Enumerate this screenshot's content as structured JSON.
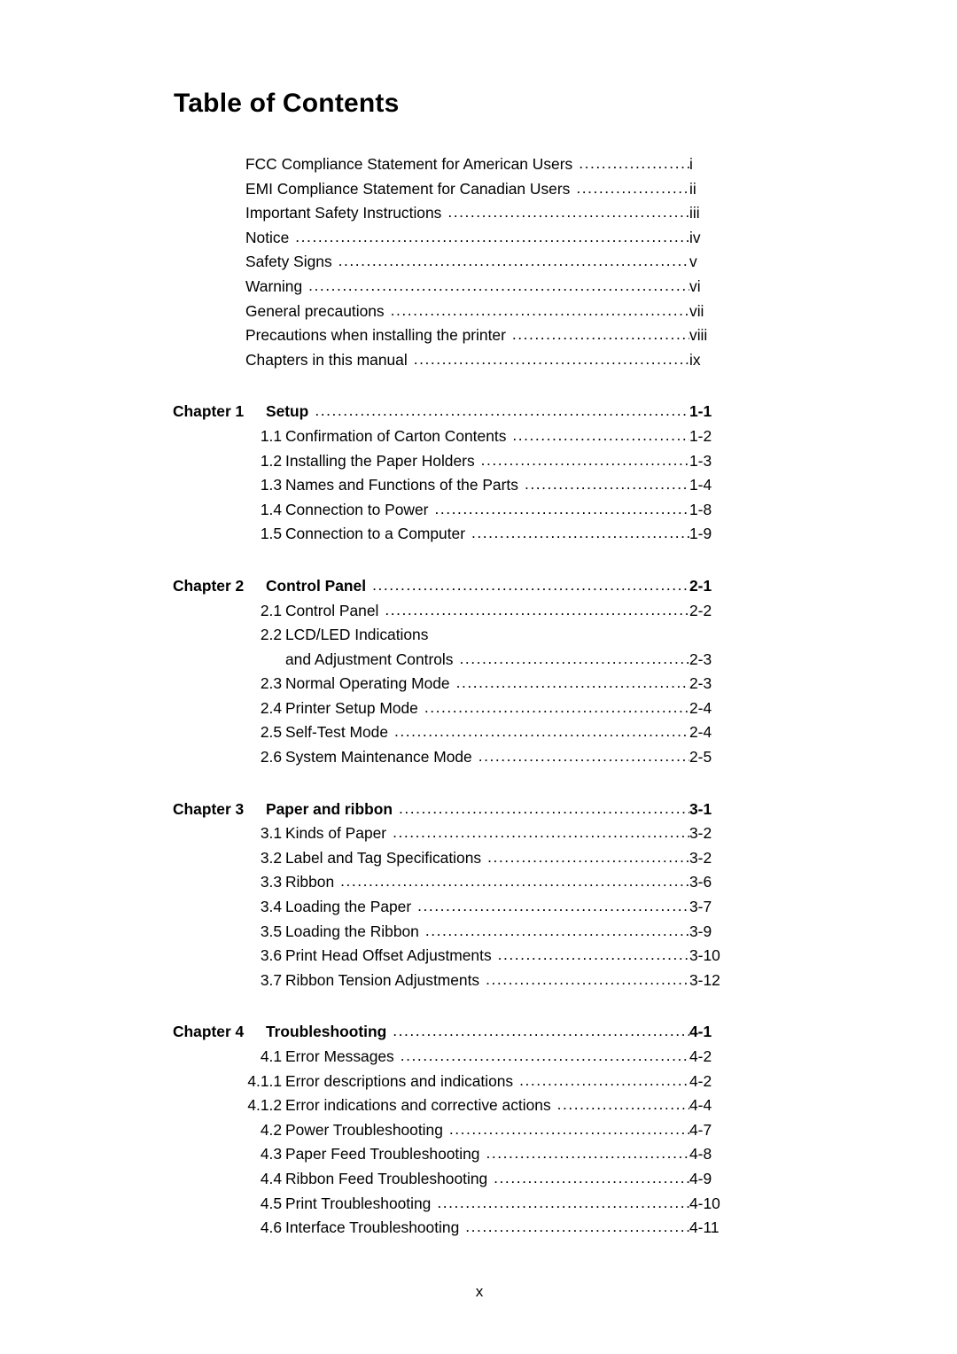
{
  "document": {
    "title": "Table of Contents",
    "folio": "x",
    "leader_char": "."
  },
  "front_matter": [
    {
      "title": "FCC Compliance Statement for American Users",
      "page": "i"
    },
    {
      "title": "EMI Compliance Statement for Canadian Users",
      "page": "ii"
    },
    {
      "title": "Important Safety Instructions",
      "page": "iii"
    },
    {
      "title": "Notice",
      "page": "iv"
    },
    {
      "title": "Safety Signs",
      "page": "v"
    },
    {
      "title": "Warning",
      "page": "vi"
    },
    {
      "title": "General precautions",
      "page": "vii"
    },
    {
      "title": "Precautions when installing the printer",
      "page": "viii"
    },
    {
      "title": "Chapters in this manual",
      "page": "ix"
    }
  ],
  "chapters": [
    {
      "label": "Chapter 1",
      "title": "Setup",
      "page": "1-1",
      "sections": [
        {
          "num": "1.1",
          "title": "Confirmation of Carton Contents",
          "page": "1-2"
        },
        {
          "num": "1.2",
          "title": "Installing the Paper Holders",
          "page": "1-3"
        },
        {
          "num": "1.3",
          "title": "Names and Functions of the Parts",
          "page": "1-4"
        },
        {
          "num": "1.4",
          "title": "Connection to Power",
          "page": "1-8"
        },
        {
          "num": "1.5",
          "title": "Connection to a Computer",
          "page": "1-9"
        }
      ]
    },
    {
      "label": "Chapter 2",
      "title": "Control Panel",
      "page": "2-1",
      "sections": [
        {
          "num": "2.1",
          "title": "Control Panel",
          "page": "2-2"
        },
        {
          "num": "2.2",
          "title": "LCD/LED Indications",
          "title_line2": "and Adjustment Controls",
          "page": "2-3"
        },
        {
          "num": "2.3",
          "title": "Normal Operating Mode",
          "page": "2-3"
        },
        {
          "num": "2.4",
          "title": "Printer Setup Mode",
          "page": "2-4"
        },
        {
          "num": "2.5",
          "title": "Self-Test Mode",
          "page": "2-4"
        },
        {
          "num": "2.6",
          "title": "System Maintenance Mode",
          "page": "2-5"
        }
      ]
    },
    {
      "label": "Chapter 3",
      "title": "Paper and ribbon",
      "page": "3-1",
      "sections": [
        {
          "num": "3.1",
          "title": "Kinds of Paper",
          "page": "3-2"
        },
        {
          "num": "3.2",
          "title": "Label and Tag Specifications",
          "page": "3-2"
        },
        {
          "num": "3.3",
          "title": "Ribbon",
          "page": "3-6"
        },
        {
          "num": "3.4",
          "title": "Loading the Paper",
          "page": "3-7"
        },
        {
          "num": "3.5",
          "title": "Loading the Ribbon",
          "page": "3-9"
        },
        {
          "num": "3.6",
          "title": "Print Head Offset Adjustments",
          "page": "3-10"
        },
        {
          "num": "3.7",
          "title": "Ribbon Tension Adjustments",
          "page": "3-12"
        }
      ]
    },
    {
      "label": "Chapter 4",
      "title": "Troubleshooting",
      "page": "4-1",
      "sections": [
        {
          "num": "4.1",
          "title": "Error Messages",
          "page": "4-2"
        },
        {
          "num": "4.1.1",
          "title": "Error descriptions and indications",
          "page": "4-2"
        },
        {
          "num": "4.1.2",
          "title": "Error indications and corrective actions",
          "page": "4-4"
        },
        {
          "num": "4.2",
          "title": "Power Troubleshooting",
          "page": "4-7"
        },
        {
          "num": "4.3",
          "title": "Paper Feed Troubleshooting",
          "page": "4-8"
        },
        {
          "num": "4.4",
          "title": "Ribbon Feed Troubleshooting",
          "page": "4-9"
        },
        {
          "num": "4.5",
          "title": "Print Troubleshooting",
          "page": "4-10"
        },
        {
          "num": "4.6",
          "title": "Interface Troubleshooting",
          "page": "4-11"
        }
      ]
    }
  ]
}
